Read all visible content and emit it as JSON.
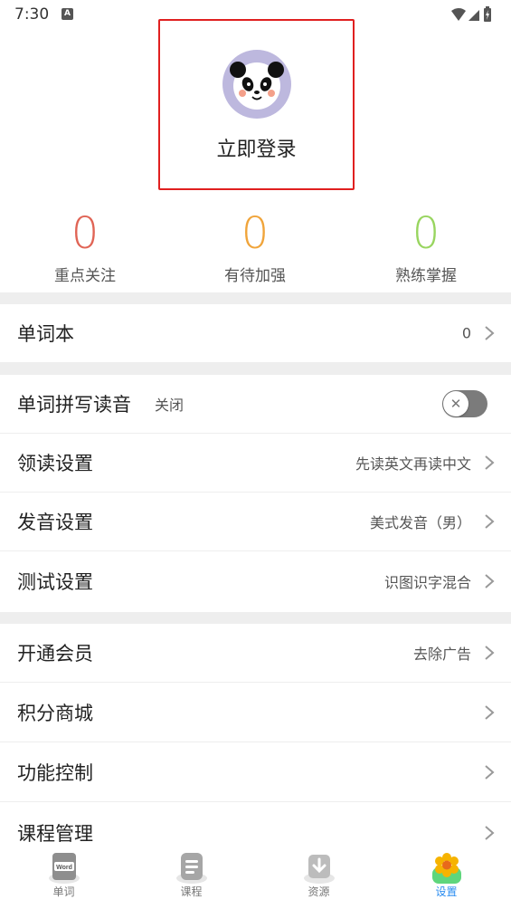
{
  "status_bar": {
    "time": "7:30",
    "a_badge": "A"
  },
  "login": {
    "label": "立即登录",
    "avatar_icon": "panda-icon"
  },
  "stats": [
    {
      "value": "0",
      "label": "重点关注",
      "color": "#e06455"
    },
    {
      "value": "0",
      "label": "有待加强",
      "color": "#f0a43a"
    },
    {
      "value": "0",
      "label": "熟练掌握",
      "color": "#98d55f"
    }
  ],
  "wordbook": {
    "title": "单词本",
    "value": "0"
  },
  "settings": {
    "spell": {
      "title": "单词拼写读音",
      "sub": "关闭",
      "toggle_on": false
    },
    "lead_read": {
      "title": "领读设置",
      "value": "先读英文再读中文"
    },
    "pronounce": {
      "title": "发音设置",
      "value": "美式发音（男）"
    },
    "test": {
      "title": "测试设置",
      "value": "识图识字混合"
    }
  },
  "more": {
    "vip": {
      "title": "开通会员",
      "value": "去除广告"
    },
    "mall": {
      "title": "积分商城"
    },
    "control": {
      "title": "功能控制"
    },
    "course_manage": {
      "title": "课程管理"
    }
  },
  "tabbar": {
    "tabs": [
      {
        "label": "单词",
        "icon": "word-book-icon",
        "icon_text": "Word"
      },
      {
        "label": "课程",
        "icon": "course-list-icon"
      },
      {
        "label": "资源",
        "icon": "download-icon"
      },
      {
        "label": "设置",
        "icon": "flower-icon"
      }
    ],
    "active": "设置",
    "active_color": "#2a8cf0"
  }
}
